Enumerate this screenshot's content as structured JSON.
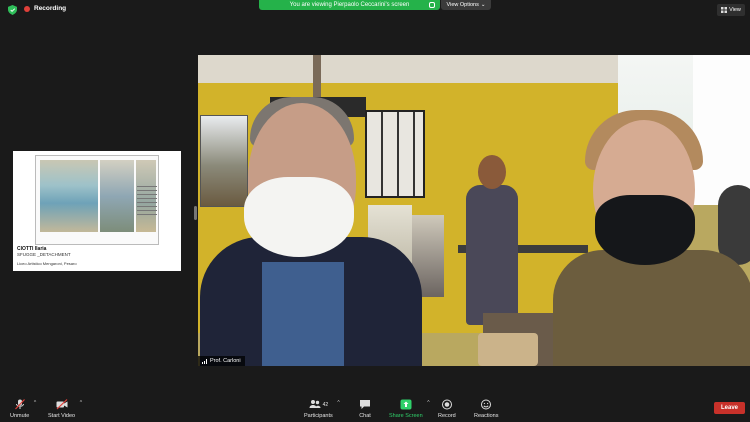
{
  "topbar": {
    "recording_label": "Recording",
    "banner_text": "You are viewing Pierpaolo Ceccarini's screen",
    "view_options_label": "View Options",
    "view_label": "View"
  },
  "shared_slide": {
    "artist": "CIOTTI Ilaria",
    "title": "SFUGGE _DETACHMENT",
    "school": "Liceo Artistico Mengaroni, Pesaro"
  },
  "video": {
    "participant_name": "Prof. Carloni"
  },
  "toolbar": {
    "unmute": "Unmute",
    "start_video": "Start Video",
    "participants": "Participants",
    "participants_count": "42",
    "chat": "Chat",
    "share_screen": "Share Screen",
    "record": "Record",
    "reactions": "Reactions",
    "leave": "Leave"
  },
  "colors": {
    "banner_green": "#25b24a",
    "share_green": "#2fd06a",
    "leave_red": "#c8312a",
    "recording_red": "#e0403a"
  },
  "icons": [
    "shield-icon",
    "record-dot-icon",
    "lock-icon",
    "chevron-down-icon",
    "grid-view-icon",
    "mic-muted-icon",
    "video-off-icon",
    "participants-icon",
    "chat-icon",
    "share-screen-icon",
    "record-icon",
    "reactions-icon",
    "signal-icon"
  ]
}
